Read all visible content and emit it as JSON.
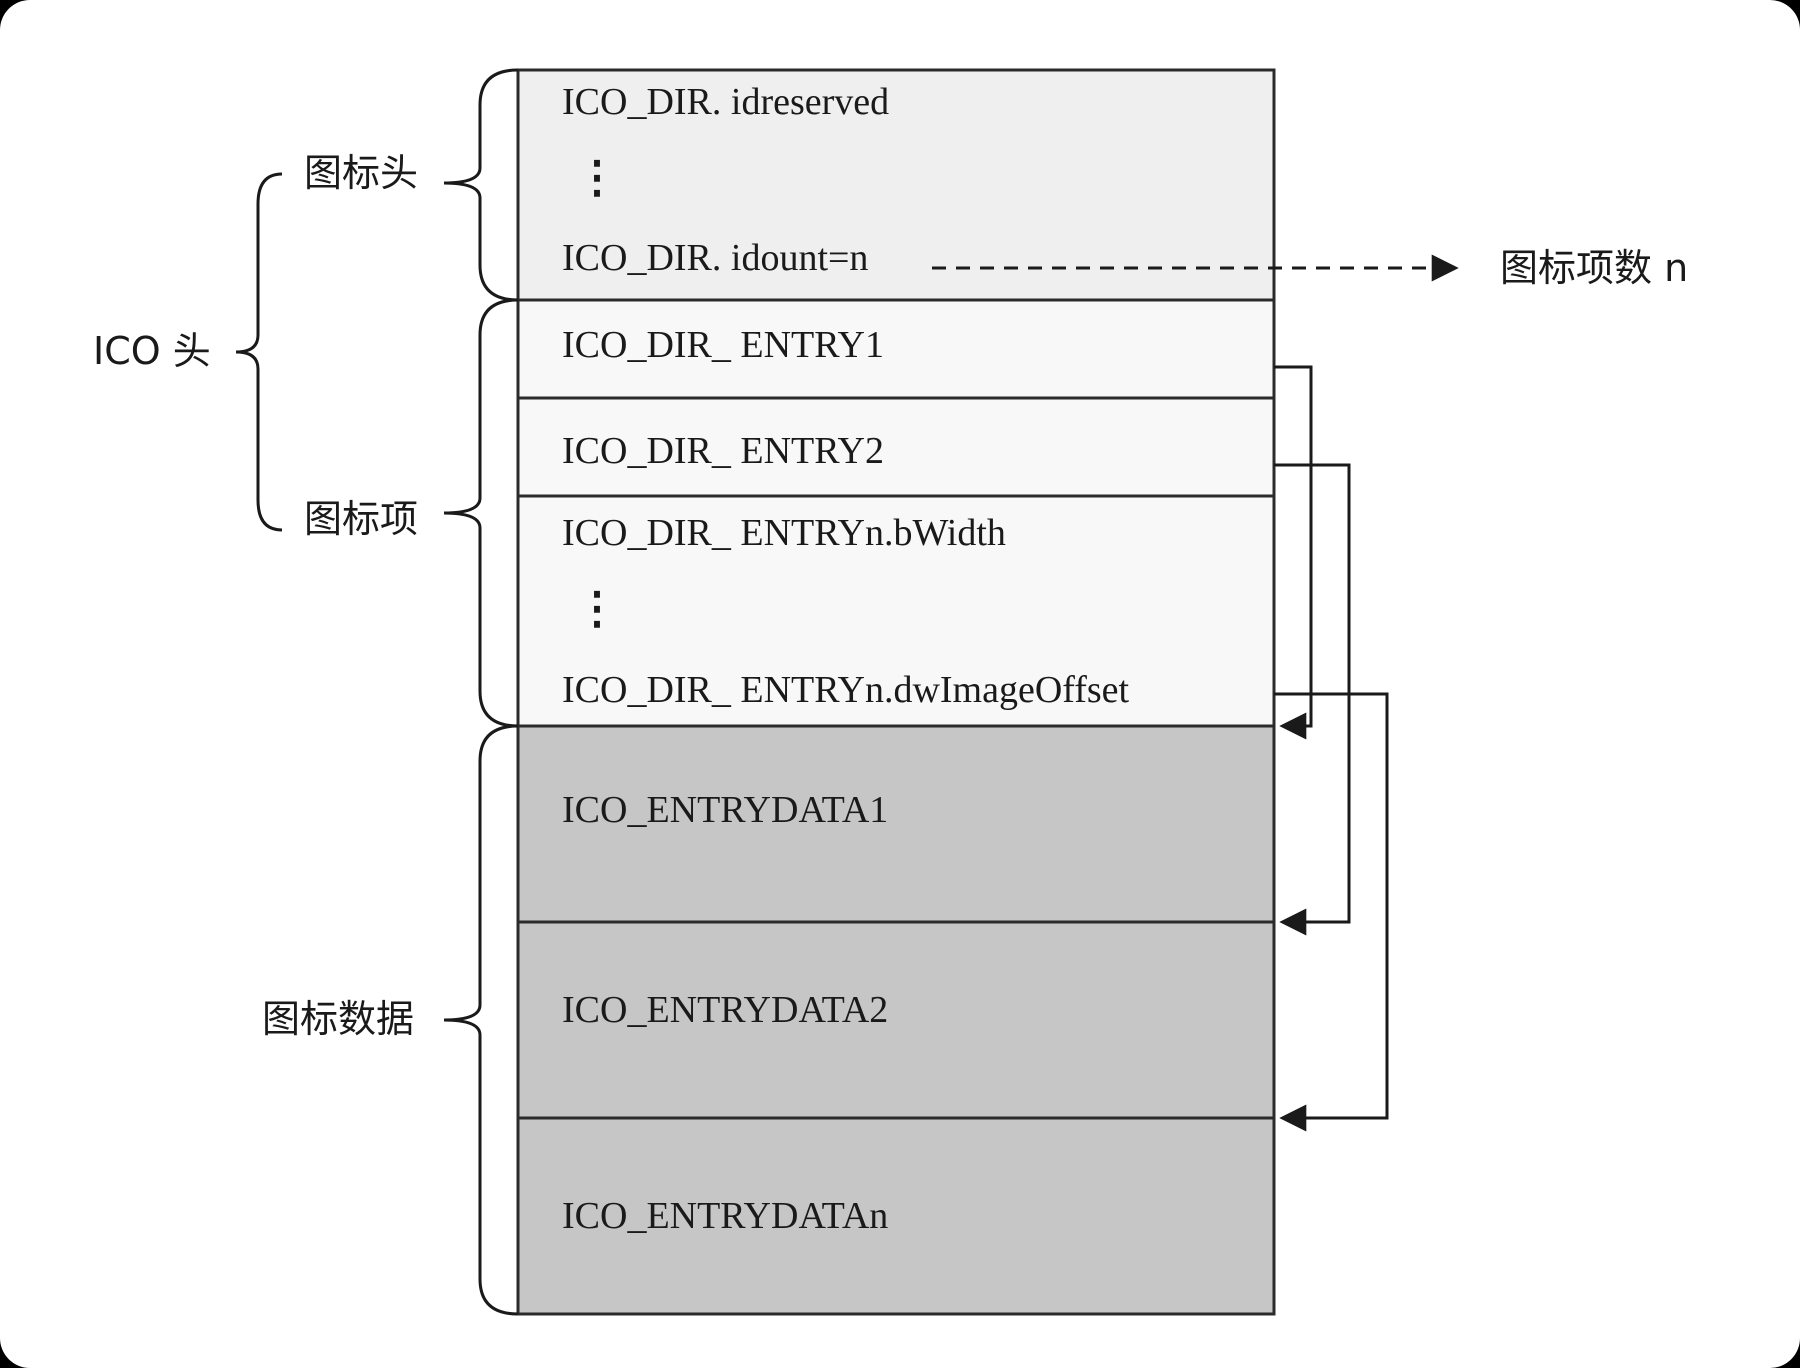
{
  "labels": {
    "ico_header": "ICO 头",
    "icon_header": "图标头",
    "icon_entry": "图标项",
    "icon_data": "图标数据",
    "icon_count": "图标项数 n"
  },
  "header_block": {
    "line1": "ICO_DIR. idreserved",
    "ellipsis": "⋮",
    "line3": "ICO_DIR. idount=n"
  },
  "entries": {
    "entry1": "ICO_DIR_ ENTRY1",
    "entry2": "ICO_DIR_ ENTRY2",
    "entryn_width": "ICO_DIR_ ENTRYn.bWidth",
    "ellipsis": "⋮",
    "entryn_offset": "ICO_DIR_ ENTRYn.dwImageOffset"
  },
  "data_blocks": {
    "data1": "ICO_ENTRYDATA1",
    "data2": "ICO_ENTRYDATA2",
    "datan": "ICO_ENTRYDATAn"
  },
  "colors": {
    "header_fill": "#efefef",
    "entry_fill": "#f8f8f8",
    "data_fill": "#c6c6c6",
    "stroke": "#2b2b2b"
  }
}
